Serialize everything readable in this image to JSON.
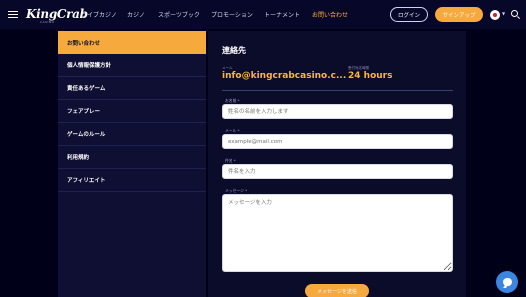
{
  "header": {
    "logo_text": "KingCrab",
    "logo_sub": "CASINO",
    "nav": [
      "ライブカジノ",
      "カジノ",
      "スポーツブック",
      "プロモーション",
      "トーナメント",
      "お問い合わせ"
    ],
    "login_label": "ログイン",
    "signup_label": "サインアップ",
    "accent_color": "#f6a93c"
  },
  "sidebar": {
    "items": [
      "お問い合わせ",
      "個人情報保護方針",
      "責任あるゲーム",
      "フェアプレー",
      "ゲームのルール",
      "利用規約",
      "アフィリエイト"
    ]
  },
  "contact": {
    "title": "連絡先",
    "email_label": "メール",
    "email_value": "info@kingcrabcasino.c...",
    "hours_label": "受付対応時間",
    "hours_value": "24 hours"
  },
  "form": {
    "name_label": "お名前 *",
    "name_placeholder": "姓名の名前を入力します",
    "email_label": "メール *",
    "email_placeholder": "example@mail.com",
    "subject_label": "件名 *",
    "subject_placeholder": "件名を入力",
    "message_label": "メッセージ *",
    "message_placeholder": "メッセージを入力",
    "submit_label": "メッセージを送信"
  }
}
